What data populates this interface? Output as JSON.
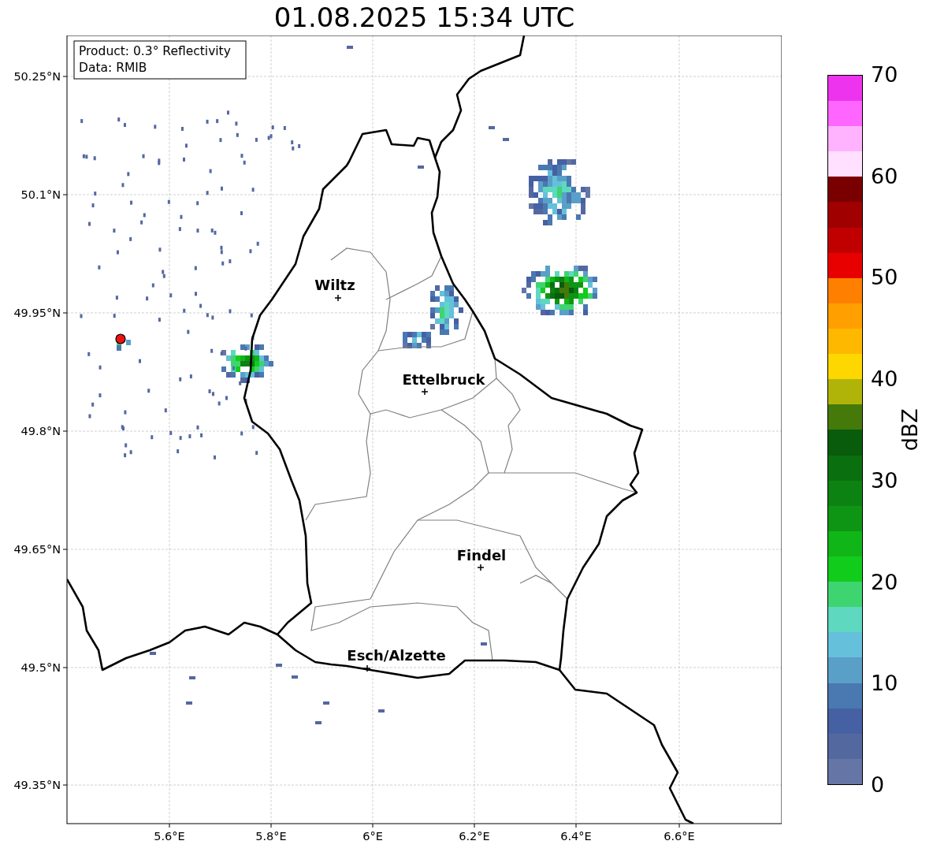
{
  "title": "01.08.2025 15:34 UTC",
  "info_box": {
    "lines": [
      "Product: 0.3° Reflectivity",
      "Data: RMIB"
    ]
  },
  "map": {
    "yticks": [
      "50.25°N",
      "50.1°N",
      "49.95°N",
      "49.8°N",
      "49.65°N",
      "49.5°N",
      "49.35°N"
    ],
    "xticks": [
      "5.6°E",
      "5.8°E",
      "6°E",
      "6.2°E",
      "6.4°E",
      "6.6°E"
    ],
    "cities": [
      {
        "name": "Wiltz"
      },
      {
        "name": "Ettelbruck"
      },
      {
        "name": "Findel"
      },
      {
        "name": "Esch/Alzette"
      }
    ]
  },
  "colorbar": {
    "label": "dBZ",
    "ticks": [
      "70",
      "60",
      "50",
      "40",
      "30",
      "20",
      "10",
      "0"
    ],
    "segments": [
      {
        "color": "#6475a6"
      },
      {
        "color": "#5468a0"
      },
      {
        "color": "#4560a3"
      },
      {
        "color": "#4a78b0"
      },
      {
        "color": "#5a9fc8"
      },
      {
        "color": "#65c0dc"
      },
      {
        "color": "#5fd8c0"
      },
      {
        "color": "#3ed470"
      },
      {
        "color": "#12cc1c"
      },
      {
        "color": "#10b518"
      },
      {
        "color": "#0f9514"
      },
      {
        "color": "#0c8212"
      },
      {
        "color": "#0a700f"
      },
      {
        "color": "#085c0c"
      },
      {
        "color": "#457a0a"
      },
      {
        "color": "#b0b408"
      },
      {
        "color": "#ffd700"
      },
      {
        "color": "#ffb800"
      },
      {
        "color": "#ff9f00"
      },
      {
        "color": "#ff8000"
      },
      {
        "color": "#e80000"
      },
      {
        "color": "#c00000"
      },
      {
        "color": "#a00000"
      },
      {
        "color": "#7a0000"
      },
      {
        "color": "#ffe0ff"
      },
      {
        "color": "#ffb3ff"
      },
      {
        "color": "#ff66ff"
      },
      {
        "color": "#ee33ee"
      }
    ]
  }
}
